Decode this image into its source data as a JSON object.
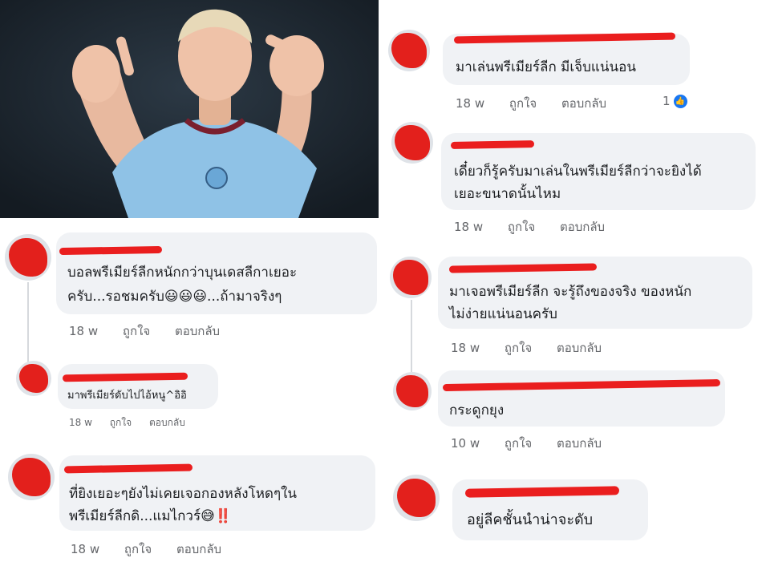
{
  "photo": {
    "alt": "football player pointing"
  },
  "colors": {
    "bubble": "#f0f2f5",
    "redaction": "#ea1e1e",
    "meta": "#65676b",
    "like": "#1877f2"
  },
  "comments": [
    {
      "text_lines": [
        "มาเล่นพรีเมียร์ลีก มีเจ็บแน่นอน"
      ],
      "time": "18 w",
      "like_label": "ถูกใจ",
      "reply_label": "ตอบกลับ",
      "reactions": "1"
    },
    {
      "text_lines": [
        "เดี๋ยวก็รู้ครับมาเล่นในพรีเมียร์ลีกว่าจะยิงได้",
        "เยอะขนาดนั้นไหม"
      ],
      "time": "18 w",
      "like_label": "ถูกใจ",
      "reply_label": "ตอบกลับ"
    },
    {
      "text_lines": [
        "บอลพรีเมียร์ลีกหนักกว่าบุนเดสลีกาเยอะ",
        "ครับ...รอชมครับ😃😃😃...ถ้ามาจริงๆ"
      ],
      "time": "18 w",
      "like_label": "ถูกใจ",
      "reply_label": "ตอบกลับ"
    },
    {
      "text_lines": [
        "มาเจอพรีเมียร์ลีก จะรู้ถึงของจริง ของหนัก",
        "ไม่ง่ายแน่นอนครับ"
      ],
      "time": "18 w",
      "like_label": "ถูกใจ",
      "reply_label": "ตอบกลับ"
    },
    {
      "text_lines": [
        "มาพรีเมียร์ดับไปไอ้หนู^อิอิ"
      ],
      "time": "18 w",
      "like_label": "ถูกใจ",
      "reply_label": "ตอบกลับ"
    },
    {
      "text_lines": [
        "กระดูกยุง"
      ],
      "time": "10 w",
      "like_label": "ถูกใจ",
      "reply_label": "ตอบกลับ"
    },
    {
      "text_lines": [
        "ที่ยิงเยอะๆยังไม่เคยเจอกองหลังโหดๆใน",
        "พรีเมียร์ลีกดิ...แมไกวร์😅‼️"
      ],
      "time": "18 w",
      "like_label": "ถูกใจ",
      "reply_label": "ตอบกลับ"
    },
    {
      "text_lines": [
        "อยู่ลีคชั้นนำน่าจะดับ"
      ]
    }
  ]
}
